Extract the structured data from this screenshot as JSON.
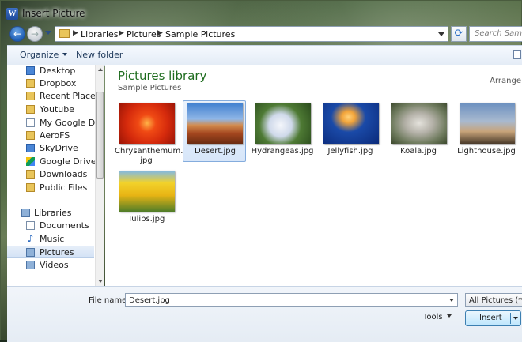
{
  "window": {
    "title": "Insert Picture",
    "app_icon_letter": "W"
  },
  "navigation": {
    "breadcrumbs": [
      "Libraries",
      "Pictures",
      "Sample Pictures"
    ],
    "search_placeholder": "Search Sample P"
  },
  "toolbar": {
    "organize_label": "Organize",
    "new_folder_label": "New folder"
  },
  "sidebar": {
    "favorites": [
      {
        "label": "Desktop",
        "icon": "desktop-icon"
      },
      {
        "label": "Dropbox",
        "icon": "folder-icon"
      },
      {
        "label": "Recent Places",
        "icon": "recent-places-icon"
      },
      {
        "label": "Youtube",
        "icon": "folder-icon"
      },
      {
        "label": "My Google Docs",
        "icon": "document-icon"
      },
      {
        "label": "AeroFS",
        "icon": "folder-icon"
      },
      {
        "label": "SkyDrive",
        "icon": "skydrive-icon"
      },
      {
        "label": "Google Drive",
        "icon": "google-drive-icon"
      },
      {
        "label": "Downloads",
        "icon": "downloads-icon"
      },
      {
        "label": "Public Files",
        "icon": "folder-icon"
      }
    ],
    "libraries_label": "Libraries",
    "libraries": [
      {
        "label": "Documents",
        "icon": "documents-icon"
      },
      {
        "label": "Music",
        "icon": "music-icon"
      },
      {
        "label": "Pictures",
        "icon": "pictures-icon",
        "selected": true
      },
      {
        "label": "Videos",
        "icon": "videos-icon"
      }
    ]
  },
  "content": {
    "library_title": "Pictures library",
    "library_subtitle": "Sample Pictures",
    "arrange_label": "Arrange",
    "files": [
      {
        "name": "Chrysanthemum.jpg",
        "name_line1": "Chrysanthemum.",
        "name_line2": "jpg",
        "colors": [
          "#f04a14",
          "#c41e0a"
        ]
      },
      {
        "name": "Desert.jpg",
        "selected": true,
        "colors": [
          "#3f7fcf",
          "#b4552a"
        ]
      },
      {
        "name": "Hydrangeas.jpg",
        "colors": [
          "#3c6b2a",
          "#dfe8f2"
        ]
      },
      {
        "name": "Jellyfish.jpg",
        "colors": [
          "#0b2a7a",
          "#f2a43a"
        ]
      },
      {
        "name": "Koala.jpg",
        "colors": [
          "#7a8a6a",
          "#c9c7c0"
        ]
      },
      {
        "name": "Lighthouse.jpg",
        "colors": [
          "#5d7fae",
          "#c8a47a"
        ]
      },
      {
        "name": "Tulips.jpg",
        "colors": [
          "#f2d22a",
          "#6a9a3a"
        ]
      }
    ]
  },
  "bottom": {
    "filename_label": "File name:",
    "filename_value": "Desert.jpg",
    "filter_value": "All Pictures (*.emf",
    "tools_label": "Tools",
    "insert_label": "Insert"
  },
  "colors": {
    "accent": "#1e6c1e",
    "selection": "#d7e6f9"
  }
}
